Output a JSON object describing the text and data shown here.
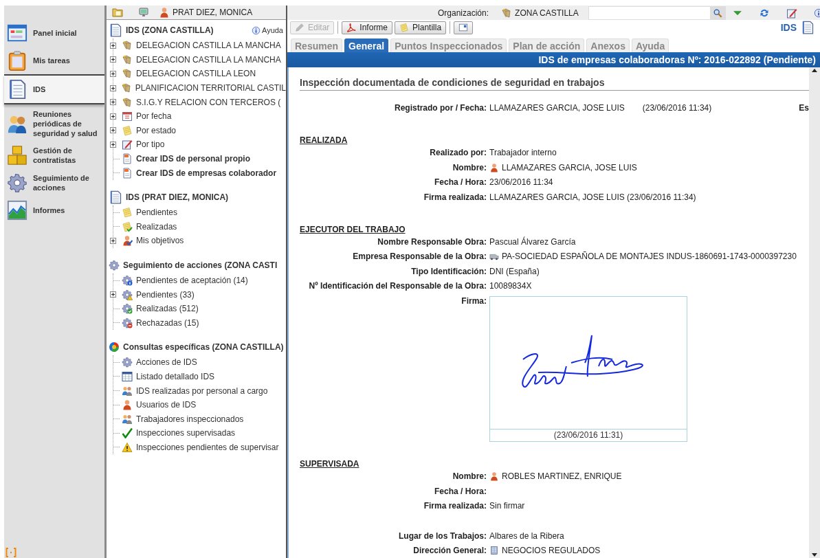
{
  "nav": {
    "items": [
      {
        "label": "Panel inicial",
        "selected": false
      },
      {
        "label": "Mis tareas",
        "selected": false
      },
      {
        "label": "IDS",
        "selected": true
      },
      {
        "label": "Reuniones periódicas de seguridad y salud",
        "selected": false
      },
      {
        "label": "Gestión de contratistas",
        "selected": false
      },
      {
        "label": "Seguimiento de acciones",
        "selected": false
      },
      {
        "label": "Informes",
        "selected": false
      }
    ]
  },
  "tree": {
    "user": "PRAT DIEZ, MONICA",
    "help": "Ayuda",
    "sections": [
      {
        "title": "IDS (ZONA CASTILLA)",
        "items": [
          {
            "label": "DELEGACION CASTILLA LA MANCHA",
            "kind": "link",
            "expandable": true
          },
          {
            "label": "DELEGACION CASTILLA LA MANCHA",
            "kind": "link",
            "expandable": true
          },
          {
            "label": "DELEGACION CASTILLA LEON",
            "kind": "link",
            "expandable": true
          },
          {
            "label": "PLANIFICACION TERRITORIAL CASTIL",
            "kind": "link",
            "expandable": true
          },
          {
            "label": "S.I.G.Y RELACION CON TERCEROS (",
            "kind": "link",
            "expandable": true
          },
          {
            "label": "Por fecha",
            "kind": "link",
            "expandable": true
          },
          {
            "label": "Por estado",
            "kind": "link",
            "expandable": true
          },
          {
            "label": "Por tipo",
            "kind": "link",
            "expandable": true
          },
          {
            "label": "Crear IDS de personal propio",
            "kind": "action",
            "expandable": false
          },
          {
            "label": "Crear IDS de empresas colaborador",
            "kind": "action",
            "expandable": false
          }
        ]
      },
      {
        "title": "IDS (PRAT DIEZ, MONICA)",
        "items": [
          {
            "label": "Pendientes",
            "kind": "link",
            "expandable": false
          },
          {
            "label": "Realizadas",
            "kind": "link",
            "expandable": false
          },
          {
            "label": "Mis objetivos",
            "kind": "link",
            "expandable": true
          }
        ]
      },
      {
        "title": "Seguimiento de acciones (ZONA CASTI",
        "items": [
          {
            "label": "Pendientes de aceptación (14)",
            "kind": "link",
            "expandable": false
          },
          {
            "label": "Pendientes (33)",
            "kind": "link",
            "expandable": true
          },
          {
            "label": "Realizadas (512)",
            "kind": "link",
            "expandable": false
          },
          {
            "label": "Rechazadas (15)",
            "kind": "link",
            "expandable": false
          }
        ]
      },
      {
        "title": "Consultas específicas (ZONA CASTILLA)",
        "items": [
          {
            "label": "Acciones de IDS",
            "kind": "link",
            "expandable": false
          },
          {
            "label": "Listado detallado IDS",
            "kind": "link",
            "expandable": false
          },
          {
            "label": "IDS realizadas por personal a cargo",
            "kind": "link",
            "expandable": false
          },
          {
            "label": "Usuarios de IDS",
            "kind": "link",
            "expandable": false
          },
          {
            "label": "Trabajadores inspeccionados",
            "kind": "link",
            "expandable": false
          },
          {
            "label": "Inspecciones supervisadas",
            "kind": "link",
            "expandable": false
          },
          {
            "label": "Inspecciones pendientes de supervisar",
            "kind": "link",
            "expandable": false
          }
        ]
      }
    ]
  },
  "topbar": {
    "org_label": "Organización:",
    "org_value": "ZONA CASTILLA"
  },
  "toolbar": {
    "buttons": [
      {
        "label": "Editar",
        "disabled": true
      },
      {
        "label": "Informe",
        "disabled": false
      },
      {
        "label": "Plantilla",
        "disabled": false
      }
    ],
    "module": "IDS"
  },
  "tabs": [
    {
      "label": "Resumen",
      "selected": false
    },
    {
      "label": "General",
      "selected": true
    },
    {
      "label": "Puntos Inspeccionados",
      "selected": false
    },
    {
      "label": "Plan de acción",
      "selected": false
    },
    {
      "label": "Anexos",
      "selected": false
    },
    {
      "label": "Ayuda",
      "selected": false
    }
  ],
  "banner": "IDS de empresas colaboradoras Nº: 2016-022892 (Pendiente)",
  "form": {
    "heading": "Inspección documentada de condiciones de seguridad en trabajos",
    "rows": [
      {
        "kind": "field",
        "label": "Registrado por / Fecha:",
        "value": "LLAMAZARES GARCIA, JOSE LUIS",
        "note": "(23/06/2016 11:34)",
        "edge": "Es"
      },
      {
        "kind": "section",
        "title": "REALIZADA"
      },
      {
        "kind": "field",
        "label": "Realizado por:",
        "value": "Trabajador interno"
      },
      {
        "kind": "person",
        "label": "Nombre:",
        "value": "LLAMAZARES GARCIA, JOSE LUIS"
      },
      {
        "kind": "field",
        "label": "Fecha / Hora:",
        "value": "23/06/2016 11:34"
      },
      {
        "kind": "field",
        "label": "Firma realizada:",
        "value": "LLAMAZARES GARCIA, JOSE LUIS (23/06/2016 11:34)"
      },
      {
        "kind": "section",
        "title": "EJECUTOR DEL TRABAJO"
      },
      {
        "kind": "field",
        "label": "Nombre Responsable Obra:",
        "value": "Pascual Álvarez García"
      },
      {
        "kind": "company",
        "label": "Empresa Responsable de la Obra:",
        "value": "PA-SOCIEDAD ESPAÑOLA DE MONTAJES INDUS-1860691-1743-0000397230"
      },
      {
        "kind": "field",
        "label": "Tipo Identificación:",
        "value": "DNI (España)"
      },
      {
        "kind": "field",
        "label": "Nº Identificación del Responsable de la Obra:",
        "value": "10089834X"
      },
      {
        "kind": "signature",
        "label": "Firma:",
        "caption": "(23/06/2016 11:31)"
      },
      {
        "kind": "section",
        "title": "SUPERVISADA"
      },
      {
        "kind": "person",
        "label": "Nombre:",
        "value": "ROBLES MARTINEZ, ENRIQUE"
      },
      {
        "kind": "field",
        "label": "Fecha / Hora:"
      },
      {
        "kind": "field",
        "label": "Firma realizada:",
        "value": "Sin firmar"
      },
      {
        "kind": "spacer"
      },
      {
        "kind": "field",
        "label": "Lugar de los Trabajos:",
        "value": "Albares de la Ribera"
      },
      {
        "kind": "department",
        "label": "Dirección General:",
        "value": "NEGOCIOS REGULADOS"
      }
    ]
  }
}
